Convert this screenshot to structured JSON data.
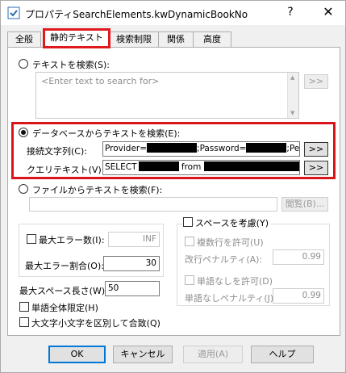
{
  "window": {
    "title": "プロパティSearchElements.kwDynamicBookNo",
    "help": "?",
    "close": "✕"
  },
  "tabs": [
    "全般",
    "静的テキスト",
    "検索制限",
    "関係",
    "高度"
  ],
  "text_search": {
    "label": "テキストを検索(S):",
    "placeholder": "<Enter text to search for>",
    "button": ">>"
  },
  "db_search": {
    "label": "データベースからテキストを検索(E):",
    "conn_label": "接続文字列(C):",
    "conn_prefix": "Provider=",
    "conn_mid": ";Password=",
    "conn_suffix": ";Persis",
    "conn_button": ">>",
    "query_label": "クエリテキスト(V):",
    "query_prefix": "SELECT",
    "query_mid": "from",
    "query_button": ">>"
  },
  "file_search": {
    "label": "ファイルからテキストを検索(F):",
    "browse": "閲覧(B)..."
  },
  "errors": {
    "max_errors_label": "最大エラー数(I):",
    "max_errors_value": "INF",
    "max_rate_label": "最大エラー割合(O):",
    "max_rate_value": "30"
  },
  "spaces": {
    "consider_label": "スペースを考慮(Y)",
    "multi_line_label": "複数行を許可(U)",
    "line_penalty_label": "改行ペナルティ(A):",
    "line_penalty_value": "0.99",
    "no_word_label": "単語なしを許可(D)",
    "no_word_penalty_label": "単語なしペナルティ(J):",
    "no_word_penalty_value": "0.99"
  },
  "misc": {
    "max_space_label": "最大スペース長さ(W):",
    "max_space_value": "50",
    "whole_word_label": "単語全体限定(H)",
    "case_label": "大文字小文字を区別して合致(Q)"
  },
  "buttons": {
    "ok": "OK",
    "cancel": "キャンセル",
    "apply": "適用(A)",
    "help": "ヘルプ"
  },
  "colors": {
    "highlight": "#d9141b",
    "window_bg": "#f0f0f0"
  }
}
